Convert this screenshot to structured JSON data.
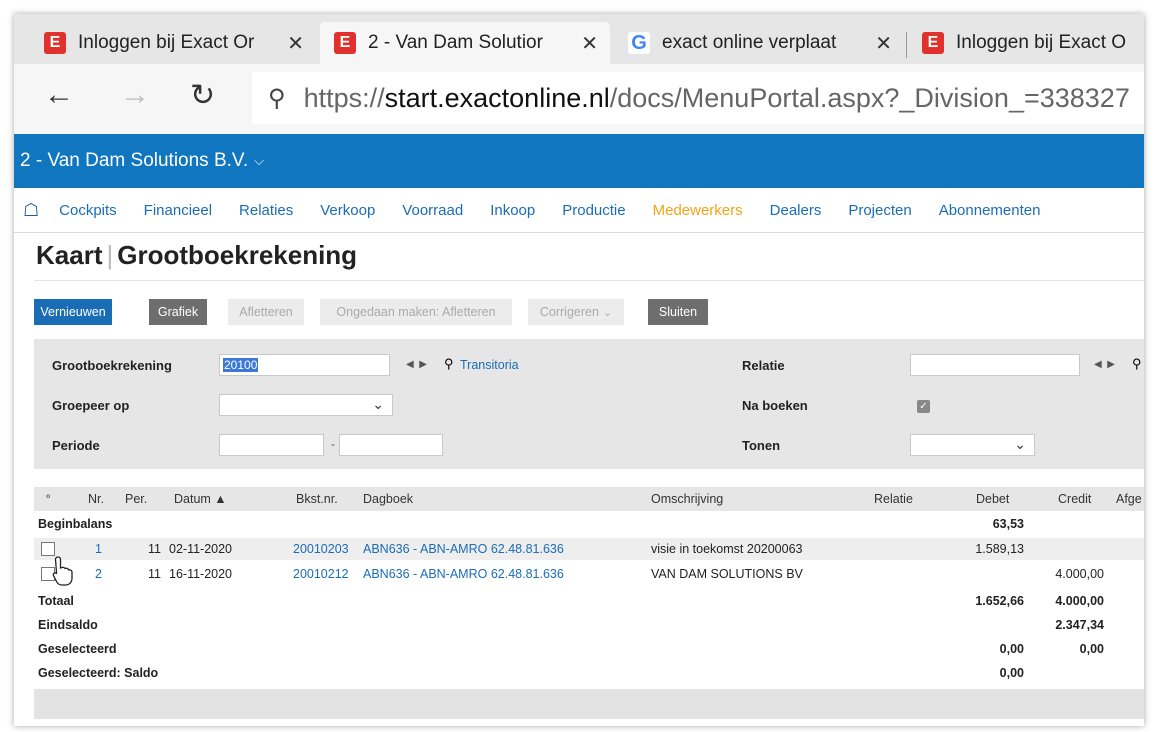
{
  "browser": {
    "tabs": [
      {
        "title": "Inloggen bij Exact Or",
        "icon": "exact-icon"
      },
      {
        "title": "2 - Van Dam Solutior",
        "icon": "exact-icon"
      },
      {
        "title": "exact online verplaat",
        "icon": "google-icon"
      },
      {
        "title": "Inloggen bij Exact O",
        "icon": "exact-icon"
      }
    ],
    "tab_close": "✕",
    "url_prefix": "https://",
    "url_domain": "start.exactonline.nl",
    "url_path": "/docs/MenuPortal.aspx?_Division_=338327"
  },
  "header": {
    "company": "2 - Van Dam Solutions B.V.",
    "company_chevron": "⌵"
  },
  "menu": {
    "items": [
      "Cockpits",
      "Financieel",
      "Relaties",
      "Verkoop",
      "Voorraad",
      "Inkoop",
      "Productie",
      "Medewerkers",
      "Dealers",
      "Projecten",
      "Abonnementen"
    ],
    "highlight_color": "#f5a315"
  },
  "page": {
    "title_part1": "Kaart",
    "title_sep": "|",
    "title_part2": "Grootboekrekening"
  },
  "toolbar": {
    "vernieuwen": "Vernieuwen",
    "grafiek": "Grafiek",
    "afletteren": "Afletteren",
    "ongedaan": "Ongedaan maken: Afletteren",
    "corrigeren": "Corrigeren",
    "sluiten": "Sluiten"
  },
  "filters": {
    "grootboek_label": "Grootboekrekening",
    "grootboek_value": "20100",
    "grootboek_link": "Transitoria",
    "groepeer_label": "Groepeer op",
    "periode_label": "Periode",
    "periode_sep": "-",
    "relatie_label": "Relatie",
    "naboeken_label": "Na boeken",
    "naboeken_checked": true,
    "tonen_label": "Tonen"
  },
  "table": {
    "headers": {
      "nr": "Nr.",
      "per": "Per.",
      "datum": "Datum ▲",
      "bkst": "Bkst.nr.",
      "dagboek": "Dagboek",
      "omschrijving": "Omschrijving",
      "relatie": "Relatie",
      "debet": "Debet",
      "credit": "Credit",
      "afge": "Afge"
    },
    "beginbalans_label": "Beginbalans",
    "beginbalans_debet": "63,53",
    "rows": [
      {
        "nr": "1",
        "per": "11",
        "datum": "02-11-2020",
        "bkst": "20010203",
        "dagboek": "ABN636 - ABN-AMRO 62.48.81.636",
        "omschrijving": "visie in toekomst 20200063",
        "debet": "1.589,13",
        "credit": ""
      },
      {
        "nr": "2",
        "per": "11",
        "datum": "16-11-2020",
        "bkst": "20010212",
        "dagboek": "ABN636 - ABN-AMRO 62.48.81.636",
        "omschrijving": "VAN DAM SOLUTIONS BV",
        "debet": "",
        "credit": "4.000,00"
      }
    ],
    "totaal_label": "Totaal",
    "totaal_debet": "1.652,66",
    "totaal_credit": "4.000,00",
    "eindsaldo_label": "Eindsaldo",
    "eindsaldo_credit": "2.347,34",
    "geselecteerd_label": "Geselecteerd",
    "geselecteerd_debet": "0,00",
    "geselecteerd_credit": "0,00",
    "saldo_label": "Geselecteerd: Saldo",
    "saldo_debet": "0,00"
  }
}
